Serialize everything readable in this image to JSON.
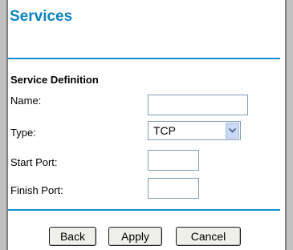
{
  "page": {
    "title": "Services"
  },
  "form": {
    "section_title": "Service Definition",
    "name": {
      "label": "Name:",
      "value": ""
    },
    "type": {
      "label": "Type:",
      "selected": "TCP"
    },
    "start_port": {
      "label": "Start Port:",
      "value": ""
    },
    "finish_port": {
      "label": "Finish Port:",
      "value": ""
    }
  },
  "buttons": {
    "back": "Back",
    "apply": "Apply",
    "cancel": "Cancel"
  },
  "colors": {
    "accent": "#0b84c0",
    "divider": "#0e8fcc",
    "frame": "#c0c0c0"
  },
  "icons": {
    "type_dropdown": "chevron-down-icon"
  }
}
